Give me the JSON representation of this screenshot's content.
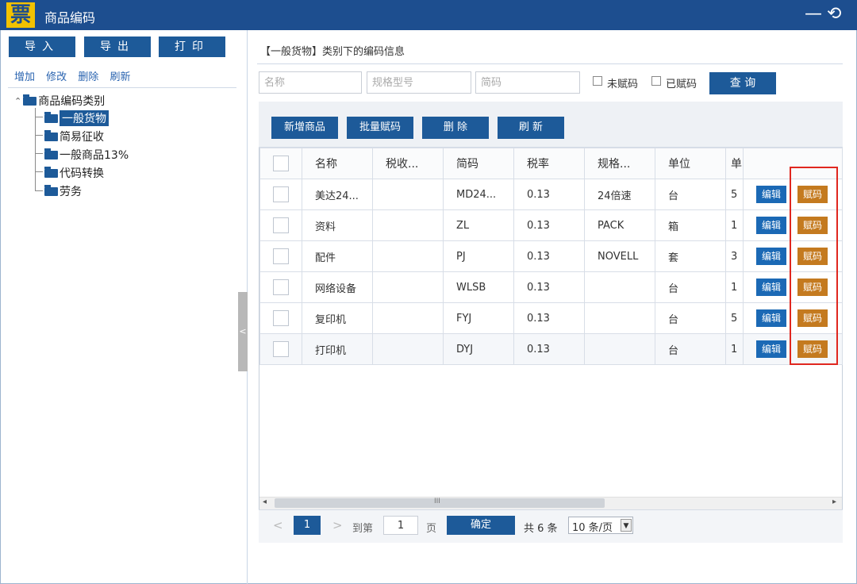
{
  "window": {
    "logo": "票",
    "title": "商品编码",
    "minimize": "—",
    "restore": "⟲"
  },
  "left_panel": {
    "buttons": [
      "导入",
      "导出",
      "打印"
    ],
    "links": [
      "增加",
      "修改",
      "删除",
      "刷新"
    ],
    "tree": {
      "root": "商品编码类别",
      "children": [
        "一般货物",
        "简易征收",
        "一般商品13%",
        "代码转换",
        "劳务"
      ]
    },
    "collapse_glyph": "<"
  },
  "main": {
    "heading": "【一般货物】类别下的编码信息",
    "search": {
      "name_placeholder": "名称",
      "spec_placeholder": "规格型号",
      "code_placeholder": "简码",
      "unassigned_label": "未赋码",
      "assigned_label": "已赋码",
      "query_button": "查 询"
    },
    "toolbar": {
      "add": "新增商品",
      "batch_assign": "批量赋码",
      "delete": "删 除",
      "refresh": "刷 新"
    },
    "table": {
      "columns": [
        "名称",
        "税收...",
        "简码",
        "税率",
        "规格...",
        "单位",
        "单"
      ],
      "rows": [
        {
          "name": "美达24...",
          "tax": "",
          "code": "MD24...",
          "rate": "0.13",
          "spec": "24倍速",
          "unit": "台",
          "price": "5"
        },
        {
          "name": "资料",
          "tax": "",
          "code": "ZL",
          "rate": "0.13",
          "spec": "PACK",
          "unit": "箱",
          "price": "1"
        },
        {
          "name": "配件",
          "tax": "",
          "code": "PJ",
          "rate": "0.13",
          "spec": "NOVELL",
          "unit": "套",
          "price": "3"
        },
        {
          "name": "网络设备",
          "tax": "",
          "code": "WLSB",
          "rate": "0.13",
          "spec": "",
          "unit": "台",
          "price": "1"
        },
        {
          "name": "复印机",
          "tax": "",
          "code": "FYJ",
          "rate": "0.13",
          "spec": "",
          "unit": "台",
          "price": "5"
        },
        {
          "name": "打印机",
          "tax": "",
          "code": "DYJ",
          "rate": "0.13",
          "spec": "",
          "unit": "台",
          "price": "1"
        }
      ],
      "edit_label": "编辑",
      "assign_label": "赋码"
    },
    "scrollbar": {
      "left": "◂",
      "grip": "III",
      "right": "▸"
    },
    "pager": {
      "prev": "<",
      "current_page": "1",
      "next": ">",
      "goto_label": "到第",
      "goto_value": "1",
      "page_unit": "页",
      "confirm": "确定",
      "total": "共 6 条",
      "page_size": "10 条/页"
    }
  },
  "colors": {
    "titlebar": "#1d4e8f",
    "primary_button": "#1d5a99",
    "edit_button": "#1b69b5",
    "assign_button": "#c47a1f",
    "highlight_box": "#e0271f"
  }
}
